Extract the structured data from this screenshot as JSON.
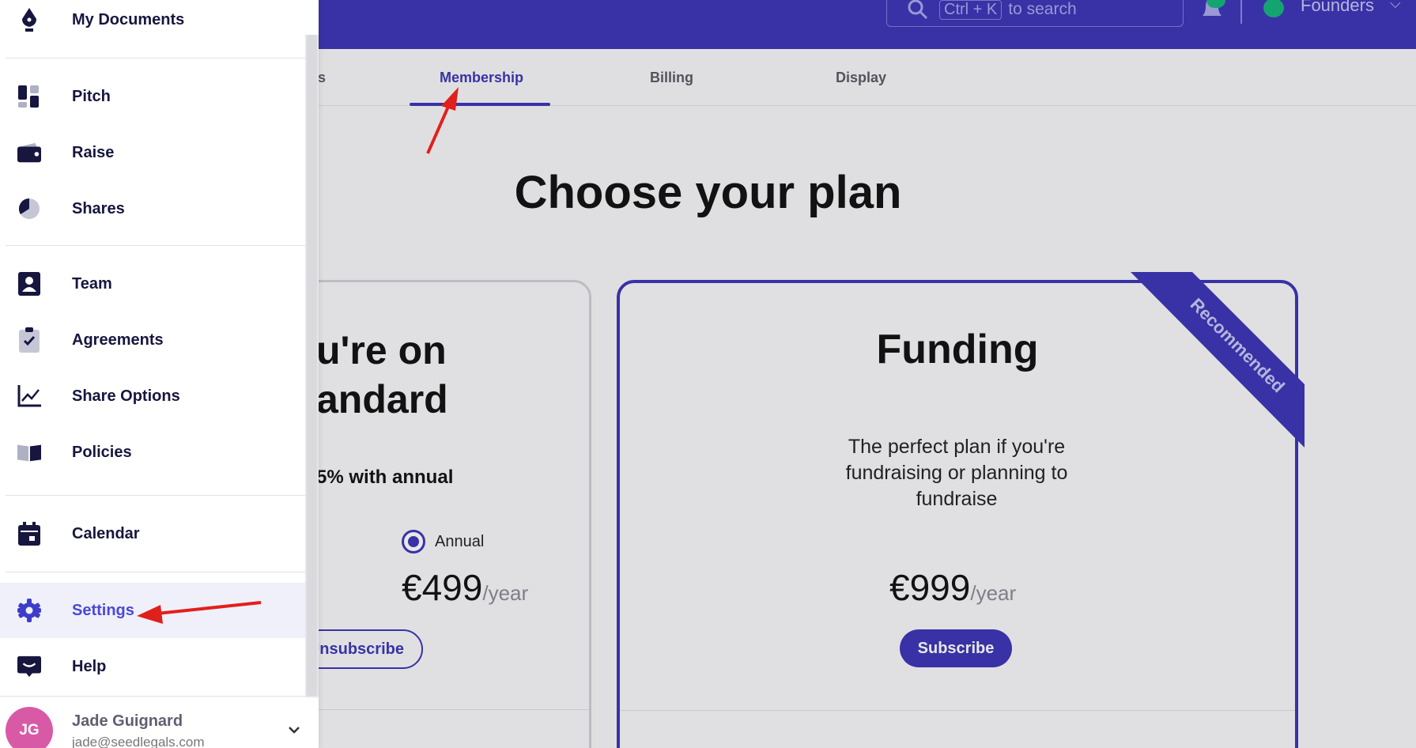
{
  "topbar": {
    "search_kbd": "Ctrl + K",
    "search_text": "to search",
    "account": "Founders"
  },
  "tabs": [
    {
      "label": "es"
    },
    {
      "label": "Membership"
    },
    {
      "label": "Billing"
    },
    {
      "label": "Display"
    }
  ],
  "page": {
    "headline": "Choose your plan"
  },
  "current_plan": {
    "title_line1": "u're on",
    "title_line2": "andard",
    "discount": "5% with annual",
    "radio_label": "Annual",
    "price": "€499",
    "period": "/year",
    "button": "Unsubscribe"
  },
  "funding_plan": {
    "ribbon": "Recommended",
    "title": "Funding",
    "description": "The perfect plan if you're fundraising or planning to fundraise",
    "price": "€999",
    "period": "/year",
    "button": "Subscribe"
  },
  "sidebar": {
    "items": [
      {
        "label": "My Documents",
        "icon": "pen-nib-icon"
      },
      {
        "label": "Pitch",
        "icon": "dashboard-icon"
      },
      {
        "label": "Raise",
        "icon": "wallet-icon"
      },
      {
        "label": "Shares",
        "icon": "pie-chart-icon"
      },
      {
        "label": "Team",
        "icon": "user-card-icon"
      },
      {
        "label": "Agreements",
        "icon": "clipboard-check-icon"
      },
      {
        "label": "Share Options",
        "icon": "line-chart-icon"
      },
      {
        "label": "Policies",
        "icon": "book-icon"
      },
      {
        "label": "Calendar",
        "icon": "calendar-icon"
      },
      {
        "label": "Settings",
        "icon": "gear-icon",
        "active": true
      },
      {
        "label": "Help",
        "icon": "chat-icon"
      }
    ],
    "user": {
      "initials": "JG",
      "name": "Jade Guignard",
      "email": "jade@seedlegals.com"
    }
  },
  "colors": {
    "brand": "#3b35b5",
    "active_nav": "#4a48d8",
    "annotation_arrow": "#e0201b"
  }
}
